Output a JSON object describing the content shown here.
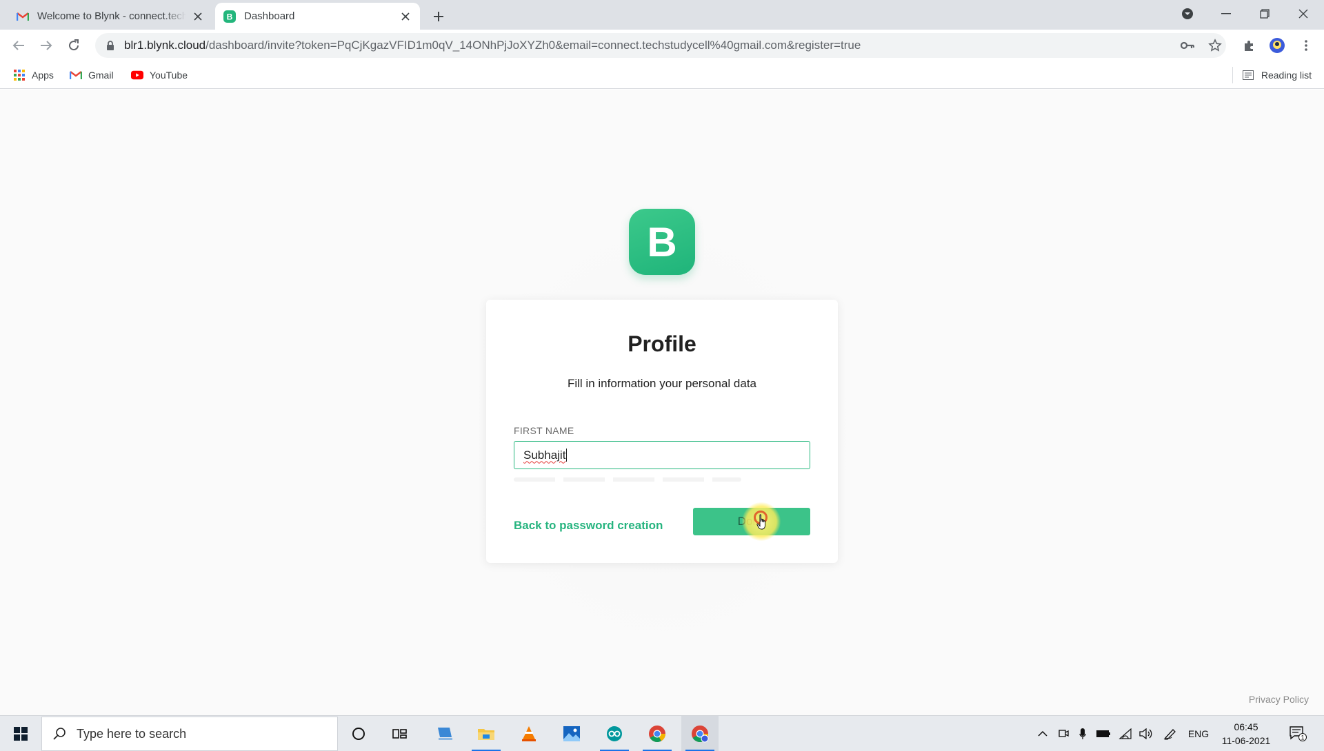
{
  "browser": {
    "tabs": [
      {
        "title": "Welcome to Blynk - connect.techstudycell@gmail.com",
        "icon": "gmail-icon",
        "active": false
      },
      {
        "title": "Dashboard",
        "icon": "blynk-favicon",
        "active": true
      }
    ],
    "url_host": "blr1.blynk.cloud",
    "url_path": "/dashboard/invite?token=PqCjKgazVFID1m0qV_14ONhPjJoXYZh0&email=connect.techstudycell%40gmail.com&register=true",
    "bookmarks": [
      {
        "label": "Apps",
        "icon": "apps-grid-icon"
      },
      {
        "label": "Gmail",
        "icon": "gmail-icon"
      },
      {
        "label": "YouTube",
        "icon": "youtube-icon"
      }
    ],
    "reading_list": "Reading list"
  },
  "page": {
    "logo_letter": "B",
    "title": "Profile",
    "subtitle": "Fill in information your personal data",
    "first_name_label": "FIRST NAME",
    "first_name_value": "Subhajit",
    "back_link": "Back to password creation",
    "done_button": "Done",
    "privacy_link": "Privacy Policy"
  },
  "taskbar": {
    "search_placeholder": "Type here to search",
    "language": "ENG",
    "time": "06:45",
    "date": "11-06-2021",
    "notification_count": "1"
  },
  "colors": {
    "brand_green": "#23b67c",
    "button_green": "#3cc389"
  }
}
